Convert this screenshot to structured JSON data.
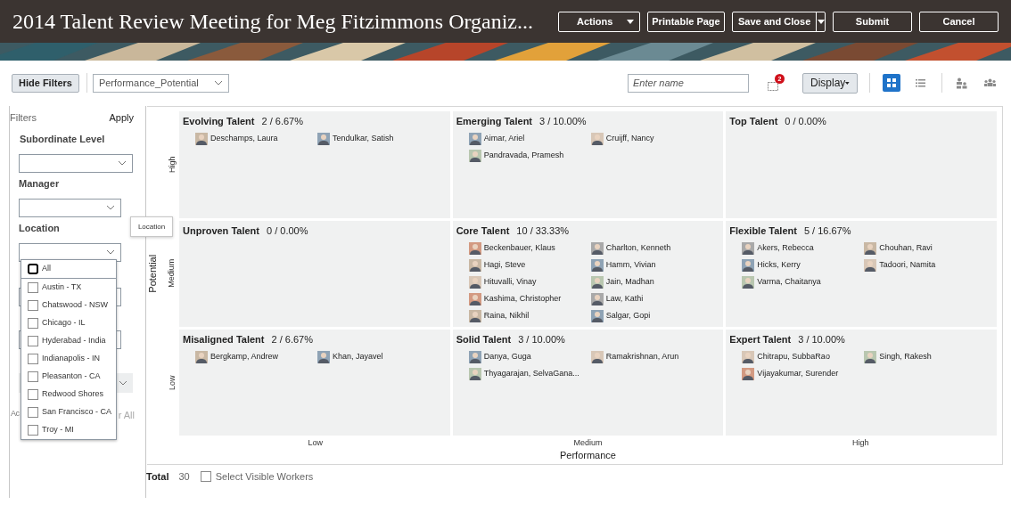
{
  "header": {
    "title": "2014 Talent Review Meeting for Meg Fitzimmons Organiz...",
    "buttons": [
      {
        "label": "Actions",
        "kind": "menu"
      },
      {
        "label": "Printable Page",
        "kind": "plain"
      },
      {
        "label": "Save and Close",
        "kind": "split"
      },
      {
        "label": "Submit",
        "kind": "plain"
      },
      {
        "label": "Cancel",
        "kind": "plain"
      }
    ]
  },
  "toolbar": {
    "hide_filters": "Hide Filters",
    "layout_select": "Performance_Potential",
    "name_field": {
      "placeholder": "Enter name"
    },
    "notification_badge": "2",
    "display_button": "Display",
    "views": [
      {
        "kind": "grid",
        "selected": true
      },
      {
        "kind": "list",
        "selected": false
      },
      {
        "kind": "org",
        "selected": false
      },
      {
        "kind": "team",
        "selected": false
      }
    ]
  },
  "filters": {
    "title": "Filters",
    "apply": "Apply",
    "fields": [
      {
        "label": "Subordinate Level"
      },
      {
        "label": "Manager"
      },
      {
        "label": "Location"
      }
    ],
    "hidden_left": "Ac",
    "hidden_right": "r All",
    "tooltip": "Location",
    "location_options": [
      {
        "label": "All",
        "checked": false,
        "kind": "all"
      },
      {
        "label": "Austin - TX",
        "checked": false,
        "kind": "item"
      },
      {
        "label": "Chatswood - NSW",
        "checked": false,
        "kind": "item"
      },
      {
        "label": "Chicago - IL",
        "checked": false,
        "kind": "item"
      },
      {
        "label": "Hyderabad - India",
        "checked": false,
        "kind": "item"
      },
      {
        "label": "Indianapolis - IN",
        "checked": false,
        "kind": "item"
      },
      {
        "label": "Pleasanton - CA",
        "checked": false,
        "kind": "item"
      },
      {
        "label": "Redwood Shores",
        "checked": false,
        "kind": "item"
      },
      {
        "label": "San Francisco - CA",
        "checked": false,
        "kind": "item"
      },
      {
        "label": "Troy - MI",
        "checked": false,
        "kind": "item"
      }
    ]
  },
  "grid": {
    "y_title": "Potential",
    "x_title": "Performance",
    "row_labels": [
      "High",
      "Medium",
      "Low"
    ],
    "column_labels": [
      "Low",
      "Medium",
      "High"
    ],
    "cells": [
      {
        "title": "Evolving Talent",
        "count": "2 / 6.67%",
        "people": [
          "Deschamps, Laura",
          "Tendulkar, Satish"
        ]
      },
      {
        "title": "Emerging Talent",
        "count": "3 / 10.00%",
        "people": [
          "Aimar, Ariel",
          "Cruijff, Nancy",
          "Pandravada, Pramesh"
        ]
      },
      {
        "title": "Top Talent",
        "count": "0 / 0.00%"
      },
      {
        "title": "Unproven Talent",
        "count": "0 / 0.00%"
      },
      {
        "title": "Core Talent",
        "count": "10 / 33.33%",
        "people": [
          "Beckenbauer, Klaus",
          "Charlton, Kenneth",
          "Hagi, Steve",
          "Hamm, Vivian",
          "Hituvalli, Vinay",
          "Jain, Madhan",
          "Kashima, Christopher",
          "Law, Kathi",
          "Raina, Nikhil",
          "Salgar, Gopi"
        ]
      },
      {
        "title": "Flexible Talent",
        "count": "5 / 16.67%",
        "people": [
          "Akers, Rebecca",
          "Chouhan, Ravi",
          "Hicks, Kerry",
          "Tadoori, Namita",
          "Varma, Chaitanya"
        ]
      },
      {
        "title": "Misaligned Talent",
        "count": "2 / 6.67%",
        "people": [
          "Bergkamp, Andrew",
          "Khan, Jayavel"
        ]
      },
      {
        "title": "Solid Talent",
        "count": "3 / 10.00%",
        "people": [
          "Danya, Guga",
          "Ramakrishnan, Arun",
          "Thyagarajan, SelvaGana..."
        ]
      },
      {
        "title": "Expert Talent",
        "count": "3 / 10.00%",
        "people": [
          "Chitrapu, SubbaRao",
          "Singh, Rakesh",
          "Vijayakumar, Surender"
        ]
      }
    ]
  },
  "footer": {
    "total_label": "Total",
    "total": "30",
    "select_visible": {
      "label": "Select Visible Workers",
      "checked": false
    }
  }
}
